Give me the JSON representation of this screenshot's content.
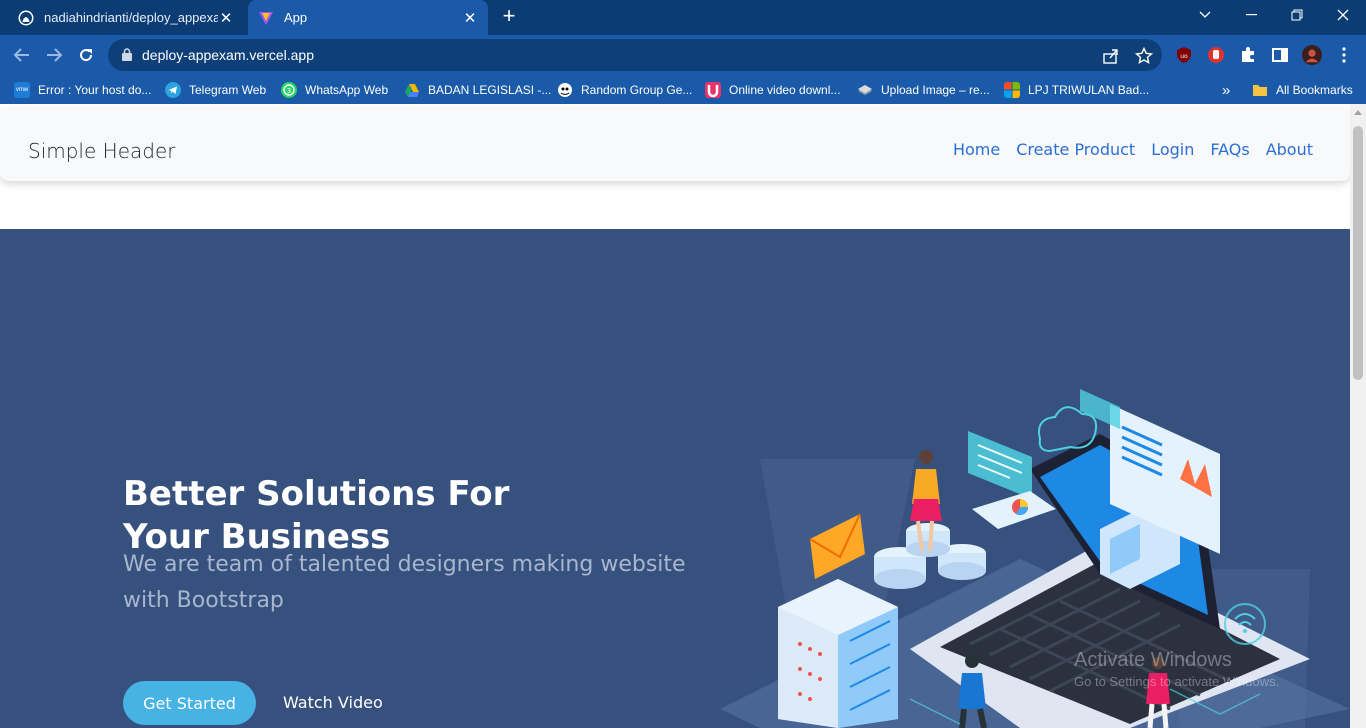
{
  "browser": {
    "tabs": [
      {
        "title": "nadiahindrianti/deploy_appexam",
        "icon": "github-icon",
        "active": false
      },
      {
        "title": "App",
        "icon": "vite-icon",
        "active": true
      }
    ],
    "new_tab": "+",
    "url": "deploy-appexam.vercel.app",
    "bookmarks": [
      {
        "label": "Error : Your host do...",
        "icon": "vmw-icon",
        "color": "#1f7bd8"
      },
      {
        "label": "Telegram Web",
        "icon": "telegram-icon",
        "color": "#2aa3df"
      },
      {
        "label": "WhatsApp Web",
        "icon": "whatsapp-icon",
        "color": "#25d366"
      },
      {
        "label": "BADAN LEGISLASI -...",
        "icon": "drive-icon",
        "color": "#f5b400"
      },
      {
        "label": "Random Group Ge...",
        "icon": "random-group-icon",
        "color": "#ffffff"
      },
      {
        "label": "Online video downl...",
        "icon": "video-download-icon",
        "color": "#e8336b"
      },
      {
        "label": "Upload Image – re...",
        "icon": "upload-image-icon",
        "color": "#9aa0a6"
      },
      {
        "label": "LPJ TRIWULAN Bad...",
        "icon": "microsoft-icon",
        "color": "#f25022"
      }
    ],
    "bookmarks_overflow": "»",
    "all_bookmarks": "All Bookmarks"
  },
  "header": {
    "brand": "Simple Header",
    "nav": [
      "Home",
      "Create Product",
      "Login",
      "FAQs",
      "About"
    ]
  },
  "hero": {
    "title": "Better Solutions For Your Business",
    "subtitle": "We are team of talented designers making website with Bootstrap",
    "get_started": "Get Started",
    "watch_video": "Watch Video",
    "background": "#37517e",
    "button_color": "#47b2e4"
  },
  "watermark": {
    "line1": "Activate Windows",
    "line2": "Go to Settings to activate Windows."
  }
}
